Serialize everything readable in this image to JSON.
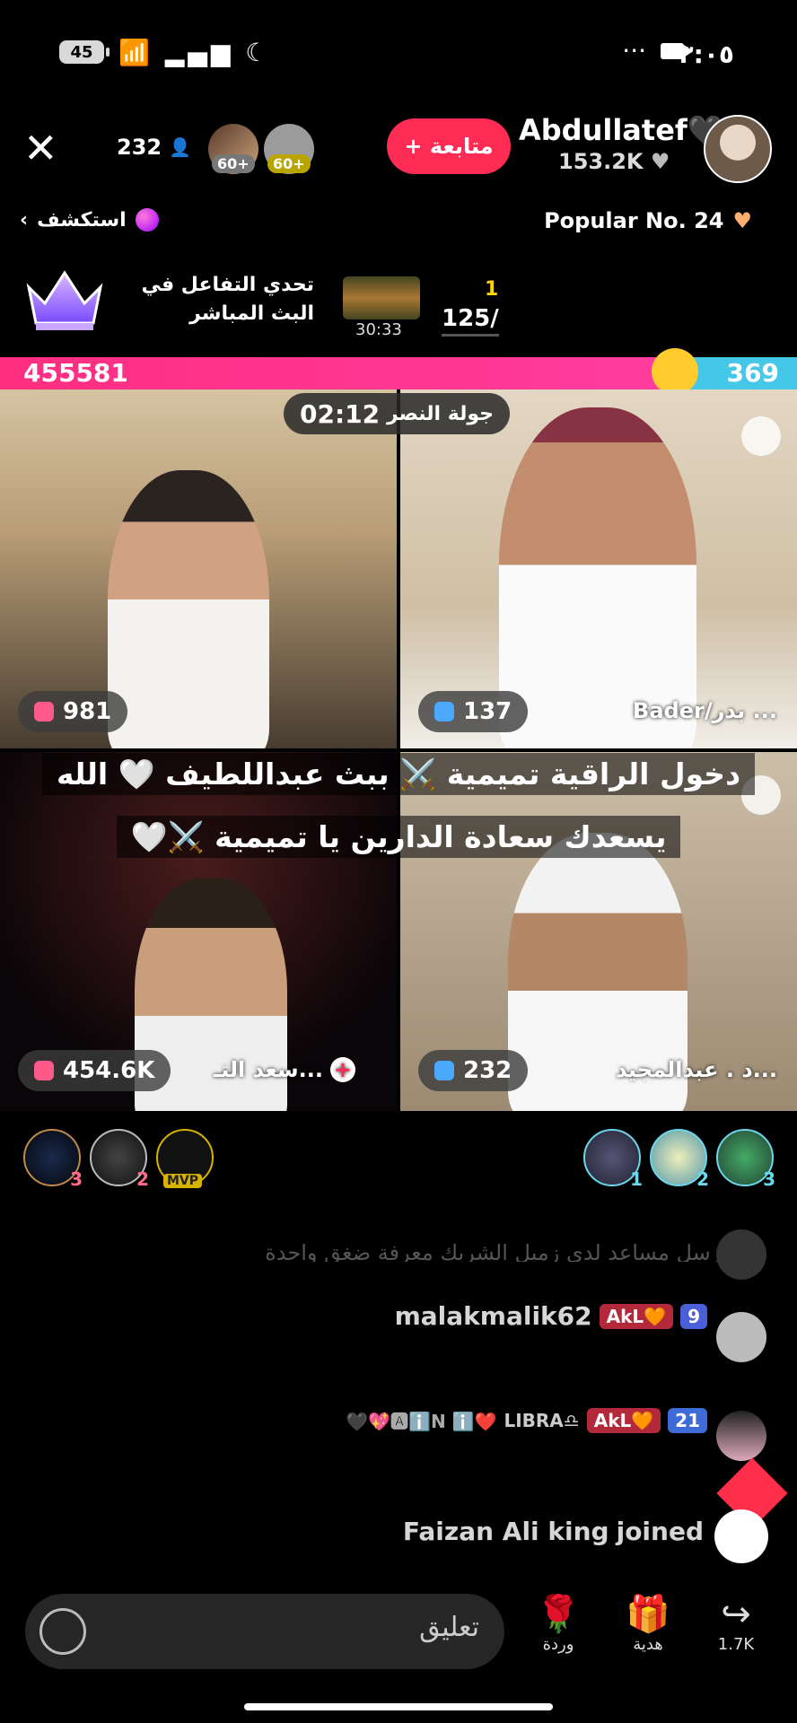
{
  "status_bar": {
    "battery": "45",
    "time": "٣:٠٥",
    "more": "···"
  },
  "header": {
    "close": "✕",
    "viewer_count": "232",
    "level_badge_1": "60+",
    "level_badge_2": "60+",
    "follow_label": "+ متابعة",
    "host_name": "Abdullatef🖤",
    "host_likes": "153.2K",
    "explore_label": "استكشف",
    "popular_label": "Popular No. 24"
  },
  "challenge": {
    "title": "تحدي التفاعل في البث المباشر",
    "timer": "30:33",
    "count_current": "1",
    "count_total": "125/"
  },
  "battle": {
    "left_score": "455581",
    "right_score": "369",
    "round_label": "جولة النصر",
    "round_time": "02:12"
  },
  "guests": [
    {
      "name": "",
      "score": "981"
    },
    {
      "name": "Bader/بدر ...",
      "score": "137"
    },
    {
      "name": "سعد التـ...",
      "score": "454.6K"
    },
    {
      "name": "د . عبدالمجيد...",
      "score": "232"
    }
  ],
  "overlay": {
    "line1": "دخول الراقية تميمية ⚔️ ببث عبداللطيف 🤍 الله",
    "line2": "يسعدك سعادة الدارين يا تميمية ⚔️🤍"
  },
  "ranking_left": [
    {
      "num": "3",
      "label": ""
    },
    {
      "num": "2",
      "label": ""
    },
    {
      "num": "",
      "label": "MVP"
    }
  ],
  "ranking_right": [
    {
      "num": "1"
    },
    {
      "num": "2"
    },
    {
      "num": "3"
    }
  ],
  "comments": {
    "faded": "ارسل مساعد لدى زميل الشريك معرفة ضغق واحدة",
    "c1_user": "malakmalik62",
    "c1_badge": "AkL🧡",
    "c1_level": "9",
    "c2_user": "LIBRA♎",
    "c2_badge": "AkL🧡",
    "c2_level": "21",
    "joined_user": "Faizan Ali king",
    "joined_text": "joined"
  },
  "bottom": {
    "comment_placeholder": "تعليق",
    "rose_label": "وردة",
    "gift_label": "هدية",
    "share_count": "1.7K"
  }
}
